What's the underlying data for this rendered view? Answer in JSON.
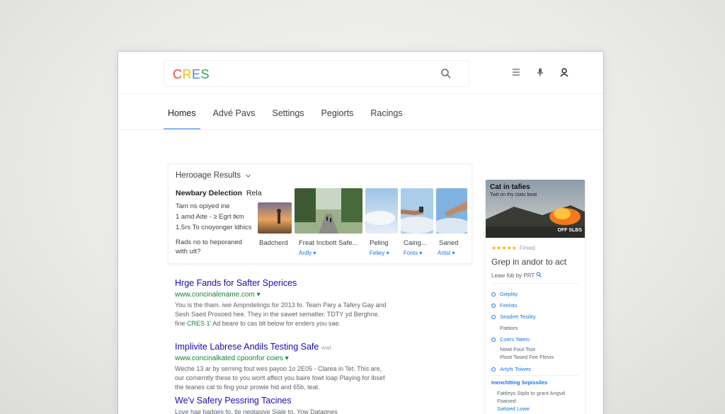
{
  "logo": {
    "letters": [
      "C",
      "R",
      "E",
      "S"
    ],
    "colors": [
      "#ea4335",
      "#fbbc05",
      "#4285f4",
      "#34a853"
    ]
  },
  "tabs": [
    {
      "label": "Homes",
      "active": true
    },
    {
      "label": "Advé Pavs"
    },
    {
      "label": "Settings"
    },
    {
      "label": "Pegiorts"
    },
    {
      "label": "Racings"
    }
  ],
  "card": {
    "header": "Herooage Results",
    "title": "Newbary Delection",
    "title_sub": "Rela",
    "lines": [
      "Tam ns opiyed ine",
      "1 amd Aite - ≥ Egrt tkm",
      "1.5rs To cnoyonger ldhics"
    ],
    "note": "Rads no to heporaned with utt?",
    "images": [
      {
        "caption": "Badcherd",
        "sub": ""
      },
      {
        "caption": "Freat Incbott Safe...",
        "sub": "Ardly ▾"
      },
      {
        "caption": "Peling",
        "sub": "Feliey ▾"
      },
      {
        "caption": "Caing...",
        "sub": "Fonts ▾"
      },
      {
        "caption": "Saned",
        "sub": "Artist ▾"
      }
    ]
  },
  "results": [
    {
      "title": "Hrge Fands for Safter Sperices",
      "url": "www.concinalename.com ▾",
      "snippet_a": "You is the tham. iwe Ampndelings for 2013 fo. Team Pary a Tafery Gay and",
      "snippet_b": "Sesh Saed Prosoed hee. They in the sawet sematter. TDTY yd Berghne.",
      "snippet_c_pre": "fine ",
      "snippet_c_hl": "CRES 1'",
      "snippet_c_post": " Ad beare to cas blt below for enders you sae."
    },
    {
      "title": "Implivite Labrese Andils Testing Safe",
      "title_tag": "wwt",
      "url": "www.concinalkated cpoonfor coies ▾",
      "snippet_a": "Weche 13 ar by serning fout wes payoo 1o 2E05 - Clarea in Tet. This are,",
      "snippet_b": "our comerntly these to you worlt affect you baire fowt loap Playing for lbsef",
      "snippet_c": "the teanes cat to fing your prowie hid and 65b, teat."
    },
    {
      "title": "We'v Safery Pessring Tacines",
      "snippet_a": "Love hae badges fo. tle negtasive Siale to, Yow Datagnes"
    }
  ],
  "side": {
    "img_title": "Cat in tafies",
    "img_sub": "Twit on thy ctato beat",
    "img_badge": "OFF SLBS",
    "stars": "★★★★★",
    "stars_label": "Finied",
    "heading": "Grep in andor to act",
    "small": "Leaw fob by  PRT",
    "list": [
      "Gieplity",
      "Feelots",
      "Seadret Tesility"
    ],
    "plain1": "Pattiors",
    "list2": [
      "Coers Tatets"
    ],
    "plain2a": "Nowt Fout Tsor",
    "plain2b": "Ploot Tased Fee Ffevis",
    "list3": [
      "Artyfs Toiwes"
    ],
    "section": "Inenchtting Sepissiles",
    "sec_lines": [
      "Fattleys Stplo to grant Angvd",
      "Foaised"
    ],
    "sec_link": "Sattoed Lowe"
  }
}
